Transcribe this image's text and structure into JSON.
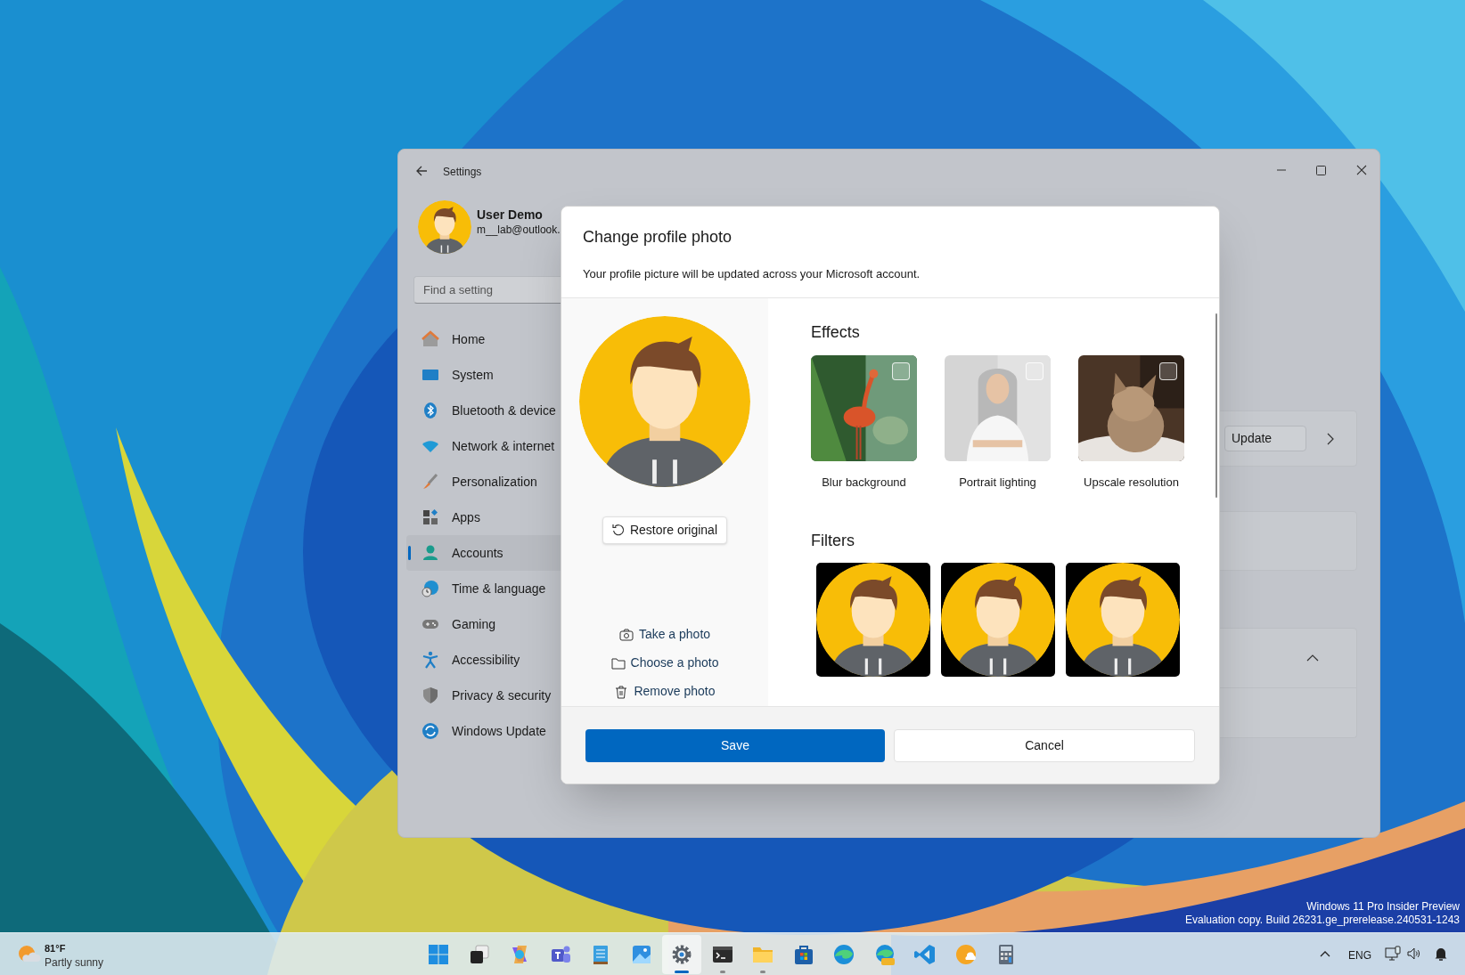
{
  "desktop": {
    "build_info": [
      "Windows 11 Pro Insider Preview",
      "Evaluation copy. Build 26231.ge_prerelease.240531-1243"
    ]
  },
  "settings_window": {
    "title": "Settings",
    "user": {
      "name": "User Demo",
      "email": "m__lab@outlook."
    },
    "search": {
      "placeholder": "Find a setting"
    },
    "nav": [
      {
        "kind": "home",
        "label": "Home",
        "selected": false
      },
      {
        "kind": "system",
        "label": "System",
        "selected": false
      },
      {
        "kind": "bluetooth",
        "label": "Bluetooth & device",
        "selected": false
      },
      {
        "kind": "network",
        "label": "Network & internet",
        "selected": false
      },
      {
        "kind": "personalization",
        "label": "Personalization",
        "selected": false
      },
      {
        "kind": "apps",
        "label": "Apps",
        "selected": false
      },
      {
        "kind": "accounts",
        "label": "Accounts",
        "selected": true
      },
      {
        "kind": "time",
        "label": "Time & language",
        "selected": false
      },
      {
        "kind": "gaming",
        "label": "Gaming",
        "selected": false
      },
      {
        "kind": "accessibility",
        "label": "Accessibility",
        "selected": false
      },
      {
        "kind": "privacy",
        "label": "Privacy & security",
        "selected": false
      },
      {
        "kind": "update",
        "label": "Windows Update",
        "selected": false
      }
    ],
    "update_button": "Update"
  },
  "dialog": {
    "title": "Change profile photo",
    "description": "Your profile picture will be updated across your Microsoft account.",
    "restore_button": "Restore original",
    "actions": [
      {
        "kind": "camera",
        "label": "Take a photo"
      },
      {
        "kind": "folder",
        "label": "Choose a photo"
      },
      {
        "kind": "trash",
        "label": "Remove photo"
      }
    ],
    "effects": {
      "heading": "Effects",
      "items": [
        {
          "kind": "bird",
          "label": "Blur background",
          "checked": false
        },
        {
          "kind": "portrait",
          "label": "Portrait lighting",
          "checked": false
        },
        {
          "kind": "cat",
          "label": "Upscale resolution",
          "checked": false
        }
      ]
    },
    "filters": {
      "heading": "Filters"
    },
    "buttons": [
      {
        "label": "Save",
        "primary": true
      },
      {
        "label": "Cancel",
        "primary": false
      }
    ]
  },
  "taskbar": {
    "weather": {
      "temperature": "81°F",
      "condition": "Partly sunny"
    },
    "apps": [
      {
        "kind": "start",
        "selected": false,
        "running": false
      },
      {
        "kind": "taskview",
        "selected": false,
        "running": false
      },
      {
        "kind": "copilot",
        "selected": false,
        "running": false
      },
      {
        "kind": "teams",
        "selected": false,
        "running": false
      },
      {
        "kind": "notepad",
        "selected": false,
        "running": false
      },
      {
        "kind": "photos",
        "selected": false,
        "running": false
      },
      {
        "kind": "settings",
        "selected": true,
        "running": true
      },
      {
        "kind": "terminal",
        "selected": false,
        "running": true
      },
      {
        "kind": "explorer",
        "selected": false,
        "running": true
      },
      {
        "kind": "store",
        "selected": false,
        "running": false
      },
      {
        "kind": "edge",
        "selected": false,
        "running": false
      },
      {
        "kind": "edgebeta",
        "selected": false,
        "running": false
      },
      {
        "kind": "code",
        "selected": false,
        "running": false
      },
      {
        "kind": "orange",
        "selected": false,
        "running": false
      },
      {
        "kind": "calculator",
        "selected": false,
        "running": false
      }
    ],
    "tray": {
      "language": "ENG"
    }
  }
}
